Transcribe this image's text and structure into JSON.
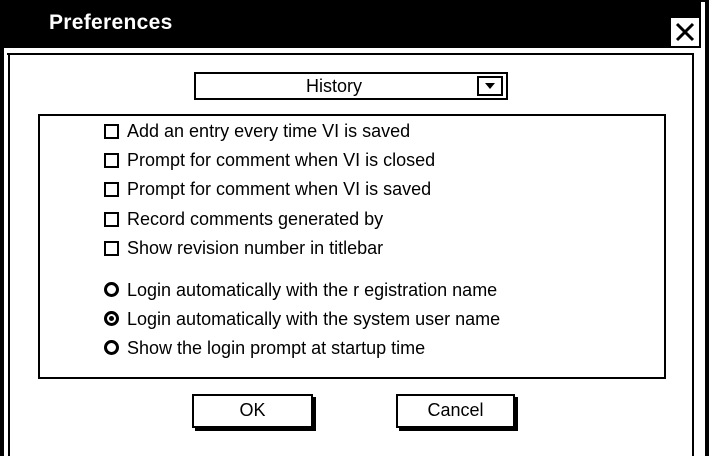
{
  "window": {
    "title": "Preferences",
    "close_icon": "close-icon"
  },
  "category_dropdown": {
    "selected": "History",
    "arrow_icon": "chevron-down-icon"
  },
  "checkboxes": [
    {
      "label": "Add an entry every time VI is saved",
      "checked": false
    },
    {
      "label": "Prompt for comment when VI is closed",
      "checked": false
    },
    {
      "label": "Prompt for comment when VI is saved",
      "checked": false
    },
    {
      "label": "Record comments generated by",
      "checked": false
    },
    {
      "label": "Show revision number in titlebar",
      "checked": false
    }
  ],
  "login_options": [
    {
      "label": "Login automatically with the  r egistration name",
      "selected": false
    },
    {
      "label": "Login automatically with the system user name",
      "selected": true
    },
    {
      "label": "Show the login prompt at startup time",
      "selected": false
    }
  ],
  "buttons": {
    "ok_label": "OK",
    "cancel_label": "Cancel"
  }
}
